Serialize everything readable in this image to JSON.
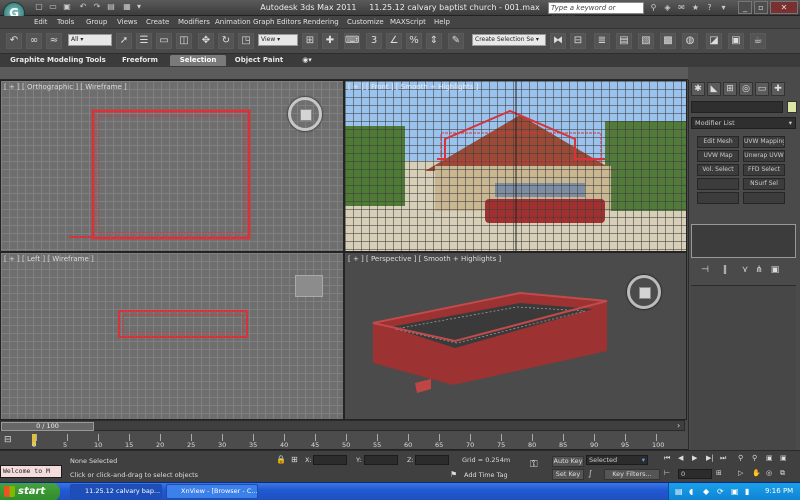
{
  "window": {
    "app_title": "Autodesk 3ds Max  2011",
    "file_title": "11.25.12 calvary baptist church - 001.max",
    "search_placeholder": "Type a keyword or phrase",
    "logo_letter": "G"
  },
  "menu": {
    "items": [
      "Edit",
      "Tools",
      "Group",
      "Views",
      "Create",
      "Modifiers",
      "Animation",
      "Graph Editors",
      "Rendering",
      "Customize",
      "MAXScript",
      "Help"
    ]
  },
  "toolbar": {
    "selection_filter": "All",
    "ref_coord": "View",
    "named_selection": "Create Selection Se"
  },
  "ribbon": {
    "tabs": [
      "Graphite Modeling Tools",
      "Freeform",
      "Selection",
      "Object Paint"
    ],
    "active_tab": "Selection"
  },
  "viewports": {
    "top_left": "[ + ] [ Orthographic ] [ Wireframe ]",
    "top_right": "[ + ] [ Front ] [ Smooth + Highlights ]",
    "bottom_left": "[ + ] [ Left ] [ Wireframe ]",
    "bottom_right": "[ + ] [ Perspective ] [ Smooth + Highlights ]"
  },
  "command_panel": {
    "modifier_list": "Modifier List",
    "modifier_buttons": [
      "Edit Mesh",
      "UVW Mapping Ad",
      "UVW Map",
      "Unwrap UVW",
      "Vol. Select",
      "FFD Select",
      "",
      "NSurf Sel",
      "",
      ""
    ]
  },
  "timeline": {
    "frame_label": "0 / 100",
    "ticks": [
      "0",
      "5",
      "10",
      "15",
      "20",
      "25",
      "30",
      "35",
      "40",
      "45",
      "50",
      "55",
      "60",
      "65",
      "70",
      "75",
      "80",
      "85",
      "90",
      "95",
      "100"
    ]
  },
  "status": {
    "maxscript": "Welcome to M",
    "selection": "None Selected",
    "prompt": "Click or click-and-drag to select objects",
    "x_label": "X:",
    "y_label": "Y:",
    "z_label": "Z:",
    "grid": "Grid = 0.254m",
    "add_time_tag": "Add Time Tag",
    "auto_key": "Auto Key",
    "set_key": "Set Key",
    "key_mode": "Selected",
    "key_filters": "Key Filters...",
    "frame_field": "0"
  },
  "taskbar": {
    "start": "start",
    "items": [
      "11.25.12 calvary bap...",
      "XnView - [Browser - C..."
    ],
    "clock": "9:16 PM"
  },
  "colors": {
    "building_red": "#b23a3a",
    "wire_red": "#d6343a",
    "taskbar_blue": "#245edb",
    "start_green": "#3c9a35"
  }
}
